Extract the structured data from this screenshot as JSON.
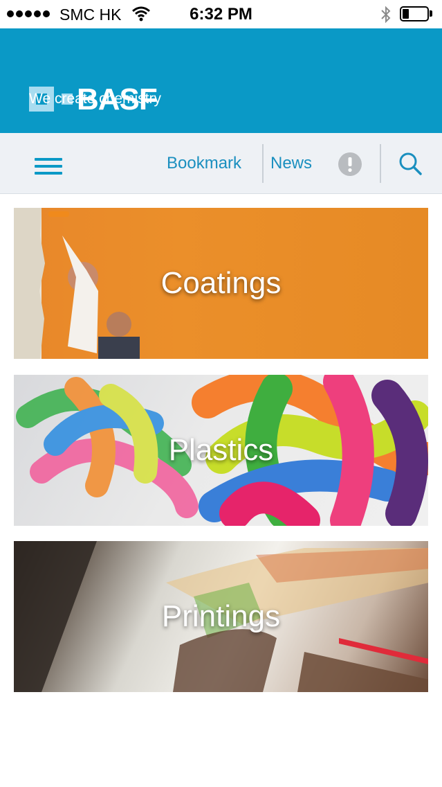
{
  "status_bar": {
    "carrier": "SMC HK",
    "time": "6:32 PM",
    "battery_level": 0.25,
    "icons": [
      "signal-dots-icon",
      "wifi-icon",
      "bluetooth-icon",
      "battery-icon"
    ]
  },
  "header": {
    "logo_text": "BASF",
    "tagline": "We create chemistry",
    "background_color": "#0a99c6"
  },
  "nav": {
    "menu_icon": "hamburger-menu-icon",
    "bookmark_label": "Bookmark",
    "news_label": "News",
    "alert_icon": "exclamation-circle-icon",
    "search_icon": "search-icon",
    "accent_color": "#1a8fbf"
  },
  "categories": [
    {
      "label": "Coatings"
    },
    {
      "label": "Plastics"
    },
    {
      "label": "Printings"
    }
  ]
}
